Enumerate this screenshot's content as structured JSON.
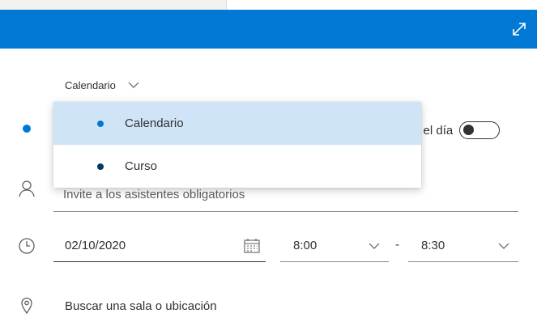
{
  "header": {
    "color": "#0078d4",
    "expand_icon": "expand-icon"
  },
  "calendar_selector": {
    "label": "Calendario",
    "icon": "chevron-down-icon"
  },
  "dropdown": {
    "items": [
      {
        "label": "Calendario",
        "dot_color": "#0078d4",
        "selected": true
      },
      {
        "label": "Curso",
        "dot_color": "#003966",
        "selected": false
      }
    ]
  },
  "all_day": {
    "label_visible": "o el día",
    "toggle_on": false
  },
  "attendees": {
    "placeholder": "Invite a los asistentes obligatorios",
    "icon": "person-icon"
  },
  "date": {
    "value": "02/10/2020",
    "icon": "calendar-icon"
  },
  "time": {
    "start": "8:00",
    "separator": "-",
    "end": "8:30"
  },
  "location": {
    "placeholder": "Buscar una sala o ubicación",
    "icon": "location-pin-icon"
  }
}
